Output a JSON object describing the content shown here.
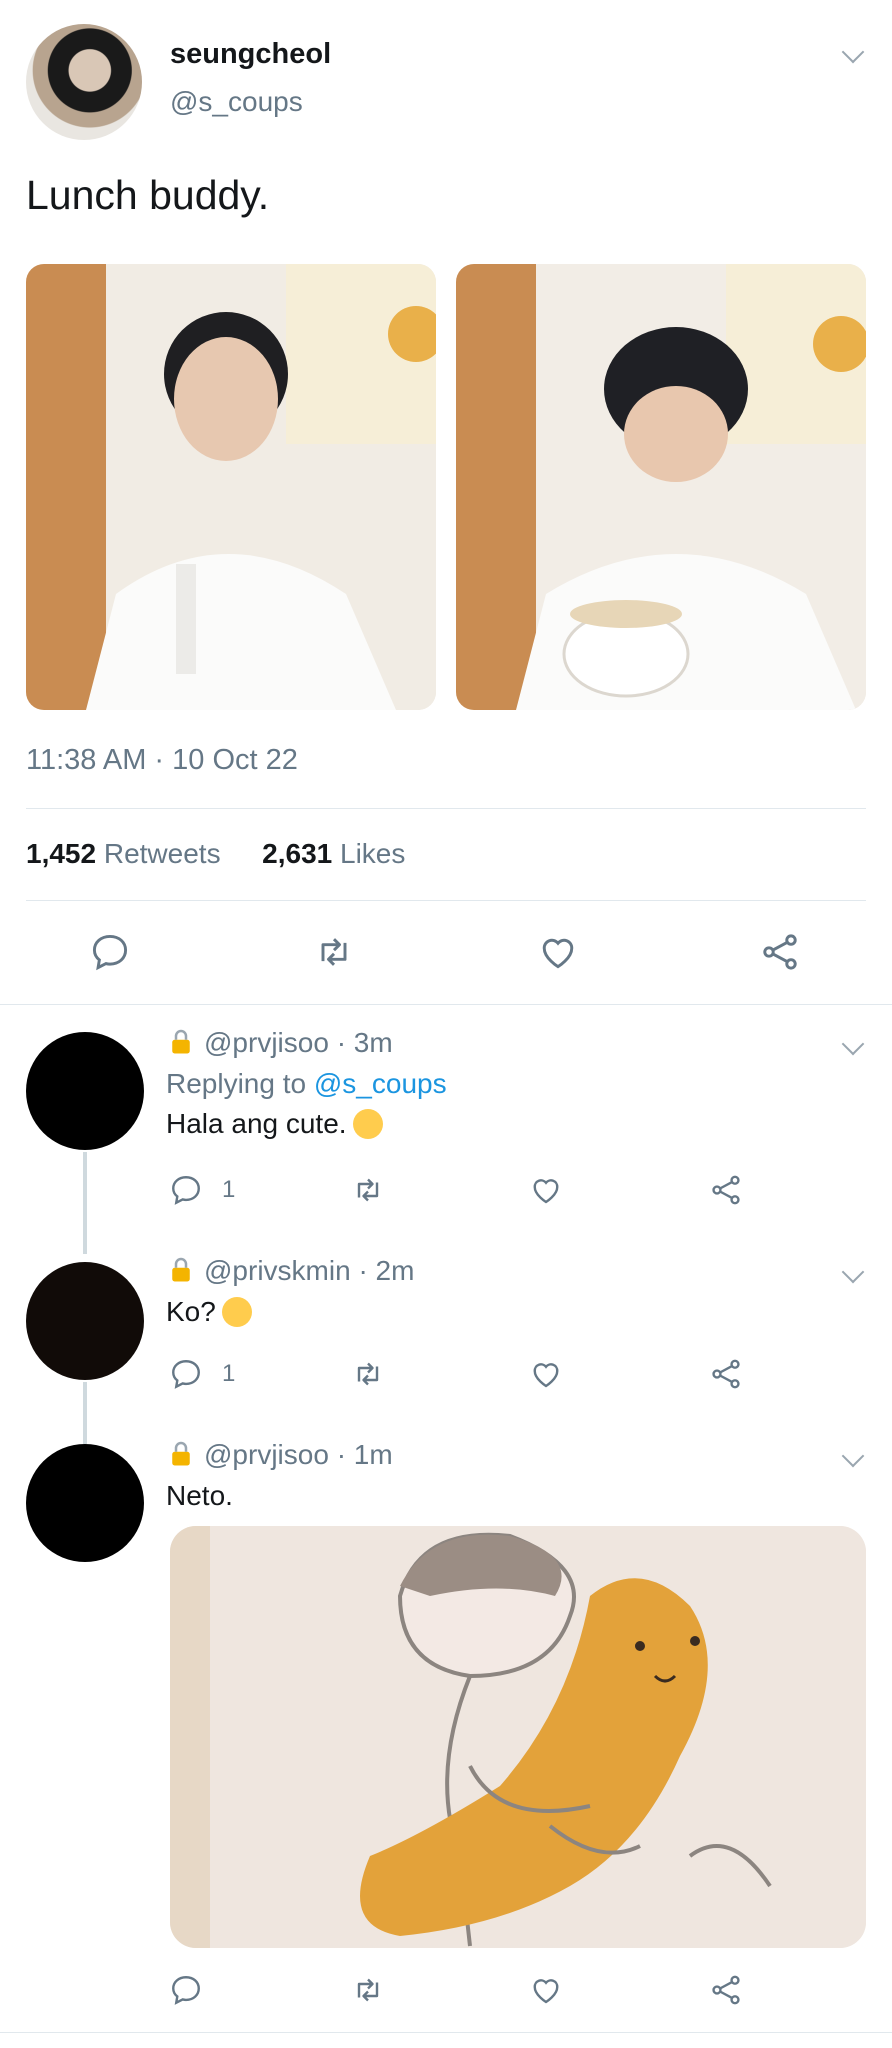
{
  "tweet": {
    "name": "seungcheol",
    "handle": "@s_coups",
    "text": "Lunch buddy.",
    "timestamp": "11:38 AM · 10 Oct 22",
    "retweets": "1,452",
    "retweets_label": "Retweets",
    "likes": "2,631",
    "likes_label": "Likes"
  },
  "replies": [
    {
      "handle": "@prvjisoo",
      "time": "· 3m",
      "replying_prefix": "Replying to",
      "replying_to": "@s_coups",
      "text": "Hala ang cute.",
      "reply_count": "1"
    },
    {
      "handle": "@privskmin",
      "time": "· 2m",
      "text": "Ko?",
      "reply_count": "1"
    },
    {
      "handle": "@prvjisoo",
      "time": "· 1m",
      "text": "Neto."
    }
  ],
  "icons": [
    "chevron-down-icon",
    "reply-icon",
    "retweet-icon",
    "like-icon",
    "share-icon",
    "lock-icon",
    "crying-face-emoji",
    "pleading-face-emoji"
  ],
  "colors": {
    "link": "#1b95e0",
    "muted": "#657786",
    "divider": "#e1e8ed",
    "lock": "#f4b400"
  }
}
